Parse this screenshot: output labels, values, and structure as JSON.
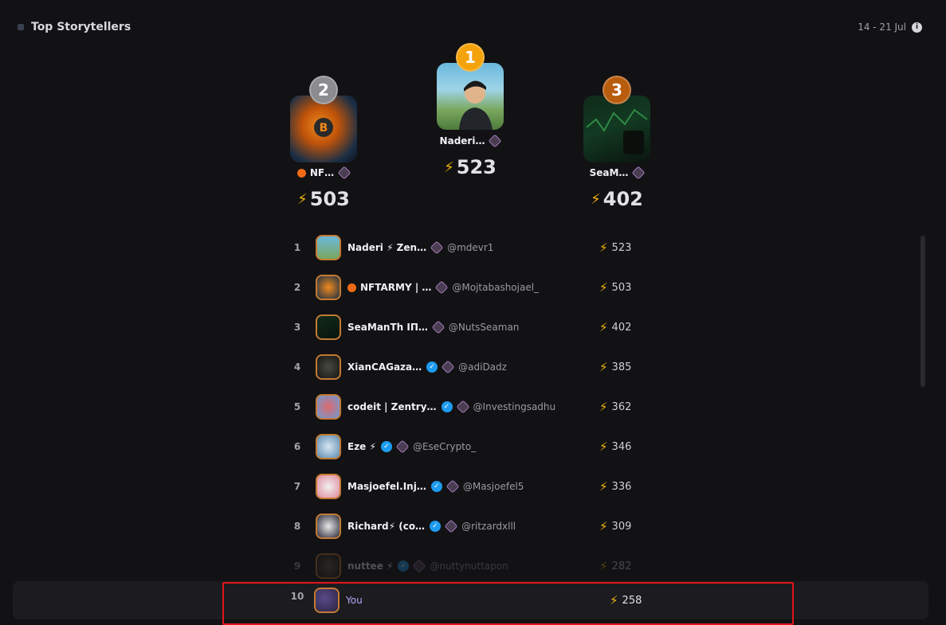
{
  "header": {
    "title": "Top Storytellers",
    "date_range": "14 - 21 Jul",
    "info_icon": "info-icon"
  },
  "colors": {
    "bolt": "#f5b70c",
    "gold": "#f5a30c",
    "silver": "#8c8c90",
    "bronze": "#b85c0e",
    "highlight": "#e0141a"
  },
  "podium": {
    "first": {
      "rank": "1",
      "name": "Naderi…",
      "score": "523"
    },
    "second": {
      "rank": "2",
      "name": "NF…",
      "score": "503"
    },
    "third": {
      "rank": "3",
      "name": "SeaM…",
      "score": "402"
    }
  },
  "leaderboard": [
    {
      "rank": "1",
      "name": "Naderi ⚡ Zen…",
      "handle": "@mdevr1",
      "score": "523"
    },
    {
      "rank": "2",
      "name": "NFTARMY | …",
      "handle": "@Mojtabashojael_",
      "score": "503"
    },
    {
      "rank": "3",
      "name": "SeaManTh IП…",
      "handle": "@NutsSeaman",
      "score": "402"
    },
    {
      "rank": "4",
      "name": "XianCAGaza…",
      "handle": "@adiDadz",
      "score": "385"
    },
    {
      "rank": "5",
      "name": "codeit | Zentry…",
      "handle": "@Investingsadhu",
      "score": "362"
    },
    {
      "rank": "6",
      "name": "Eze ⚡",
      "handle": "@EseCrypto_",
      "score": "346"
    },
    {
      "rank": "7",
      "name": "Masjoefel.Inj…",
      "handle": "@Masjoefel5",
      "score": "336"
    },
    {
      "rank": "8",
      "name": "Richard⚡ (co…",
      "handle": "@ritzardxlll",
      "score": "309"
    },
    {
      "rank": "9",
      "name": "nuttee ⚡",
      "handle": "@nuttynuttapon",
      "score": "282"
    }
  ],
  "you": {
    "rank": "10",
    "name": "You",
    "score": "258"
  }
}
